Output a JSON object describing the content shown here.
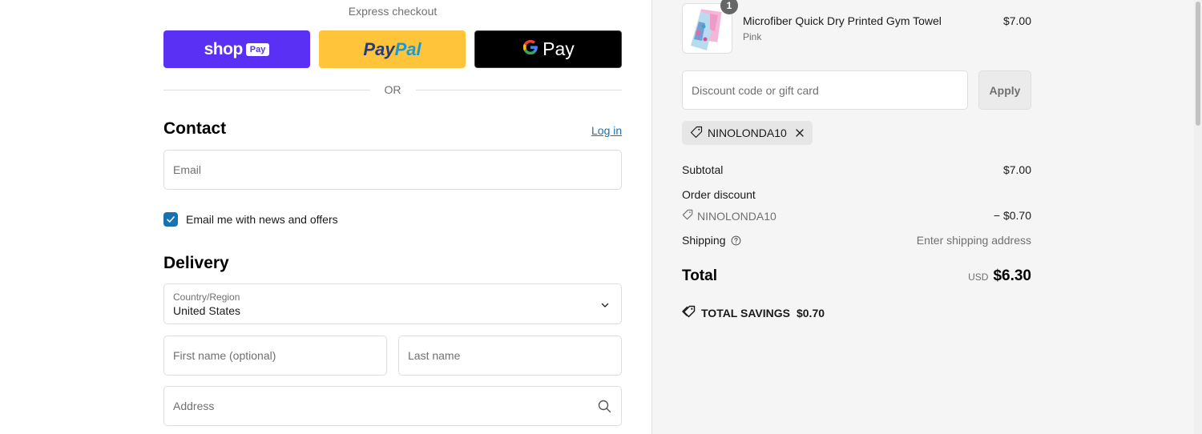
{
  "express": {
    "title": "Express checkout",
    "shop_pay": {
      "word": "shop",
      "badge": "Pay"
    },
    "paypal": {
      "part1": "Pay",
      "part2": "Pal"
    },
    "gpay": {
      "g": "G",
      "word": "Pay"
    },
    "divider": "OR"
  },
  "contact": {
    "title": "Contact",
    "login_label": "Log in",
    "email_placeholder": "Email",
    "newsletter_label": "Email me with news and offers",
    "newsletter_checked": true
  },
  "delivery": {
    "title": "Delivery",
    "country_label": "Country/Region",
    "country_value": "United States",
    "first_name_placeholder": "First name (optional)",
    "last_name_placeholder": "Last name",
    "address_placeholder": "Address"
  },
  "order": {
    "item": {
      "name": "Microfiber Quick Dry Printed Gym Towel",
      "variant": "Pink",
      "price": "$7.00",
      "quantity": "1"
    },
    "discount_placeholder": "Discount code or gift card",
    "apply_label": "Apply",
    "applied_code": "NINOLONDA10",
    "subtotal_label": "Subtotal",
    "subtotal_value": "$7.00",
    "order_discount_label": "Order discount",
    "discount_code": "NINOLONDA10",
    "discount_value": "− $0.70",
    "shipping_label": "Shipping",
    "shipping_value": "Enter shipping address",
    "total_label": "Total",
    "total_currency": "USD",
    "total_value": "$6.30",
    "savings_label": "TOTAL SAVINGS",
    "savings_value": "$0.70"
  },
  "colors": {
    "shop_pay": "#5a31f4",
    "paypal": "#ffc439",
    "gpay": "#000000",
    "link": "#1773b0",
    "sidebar_bg": "#f5f5f5"
  }
}
